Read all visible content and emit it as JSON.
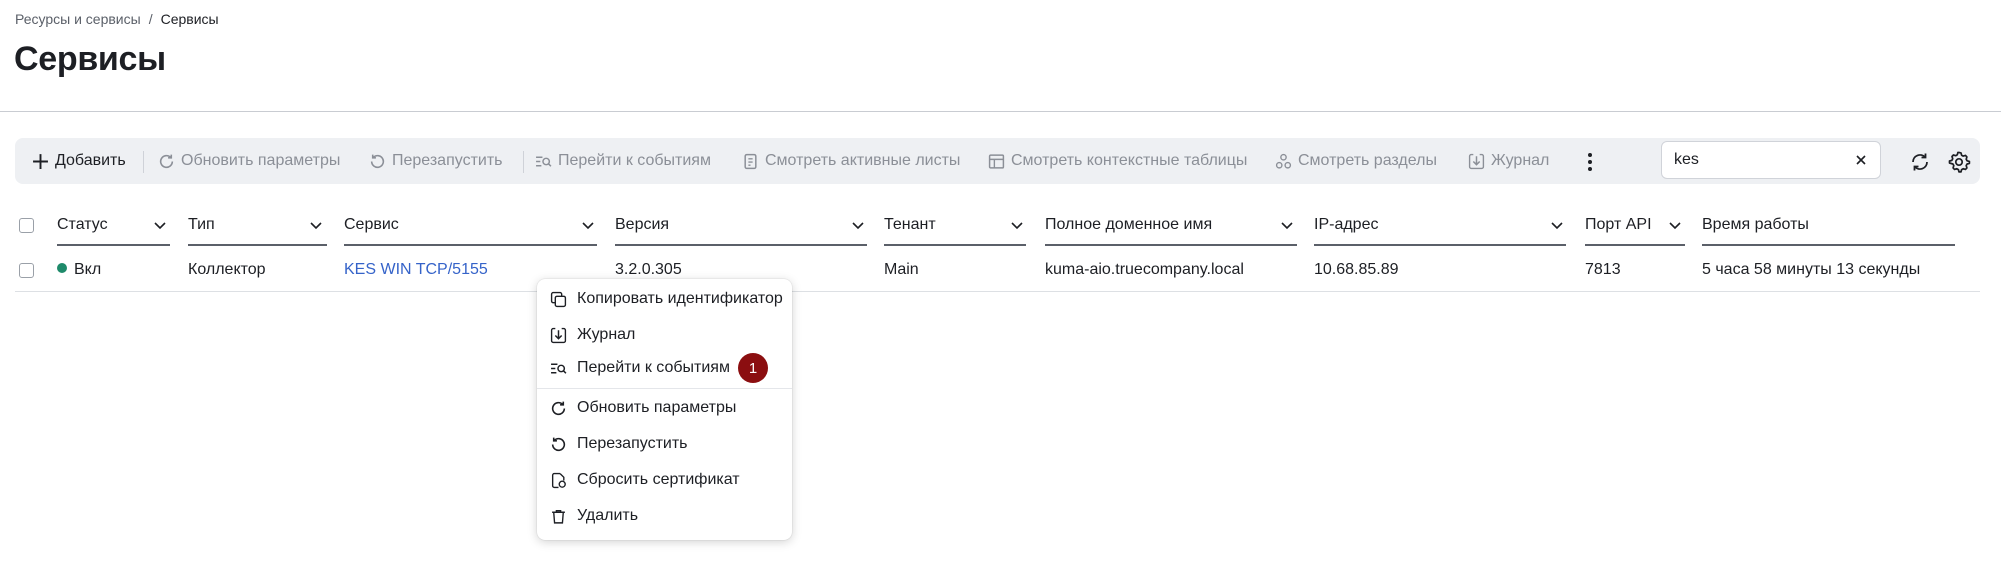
{
  "breadcrumb": {
    "parent": "Ресурсы и сервисы",
    "separator": "/",
    "current": "Сервисы"
  },
  "page_title": "Сервисы",
  "toolbar": {
    "add": "Добавить",
    "update_params": "Обновить параметры",
    "restart": "Перезапустить",
    "go_to_events": "Перейти к событиям",
    "active_lists": "Смотреть активные листы",
    "context_tables": "Смотреть контекстные таблицы",
    "partitions": "Смотреть разделы",
    "journal": "Журнал",
    "search_value": "kes"
  },
  "table": {
    "columns": [
      "Статус",
      "Тип",
      "Сервис",
      "Версия",
      "Тенант",
      "Полное доменное имя",
      "IP-адрес",
      "Порт API",
      "Время работы"
    ],
    "rows": [
      {
        "status": "Вкл",
        "status_color": "#1e8a6a",
        "type": "Коллектор",
        "service": "KES WIN TCP/5155",
        "version": "3.2.0.305",
        "tenant": "Main",
        "fqdn": "kuma-aio.truecompany.local",
        "ip": "10.68.85.89",
        "api_port": "7813",
        "uptime": "5 часа 58 минуты 13 секунды"
      }
    ]
  },
  "context_menu": {
    "items": [
      {
        "label": "Копировать идентификатор",
        "icon": "copy-icon"
      },
      {
        "label": "Журнал",
        "icon": "download-icon"
      },
      {
        "label": "Перейти к событиям",
        "icon": "events-search-icon"
      },
      {
        "label": "Обновить параметры",
        "icon": "refresh-icon"
      },
      {
        "label": "Перезапустить",
        "icon": "restart-icon"
      },
      {
        "label": "Сбросить сертификат",
        "icon": "certificate-reset-icon"
      },
      {
        "label": "Удалить",
        "icon": "trash-icon"
      }
    ],
    "badge": "1",
    "badge_color": "#8b0e10"
  }
}
